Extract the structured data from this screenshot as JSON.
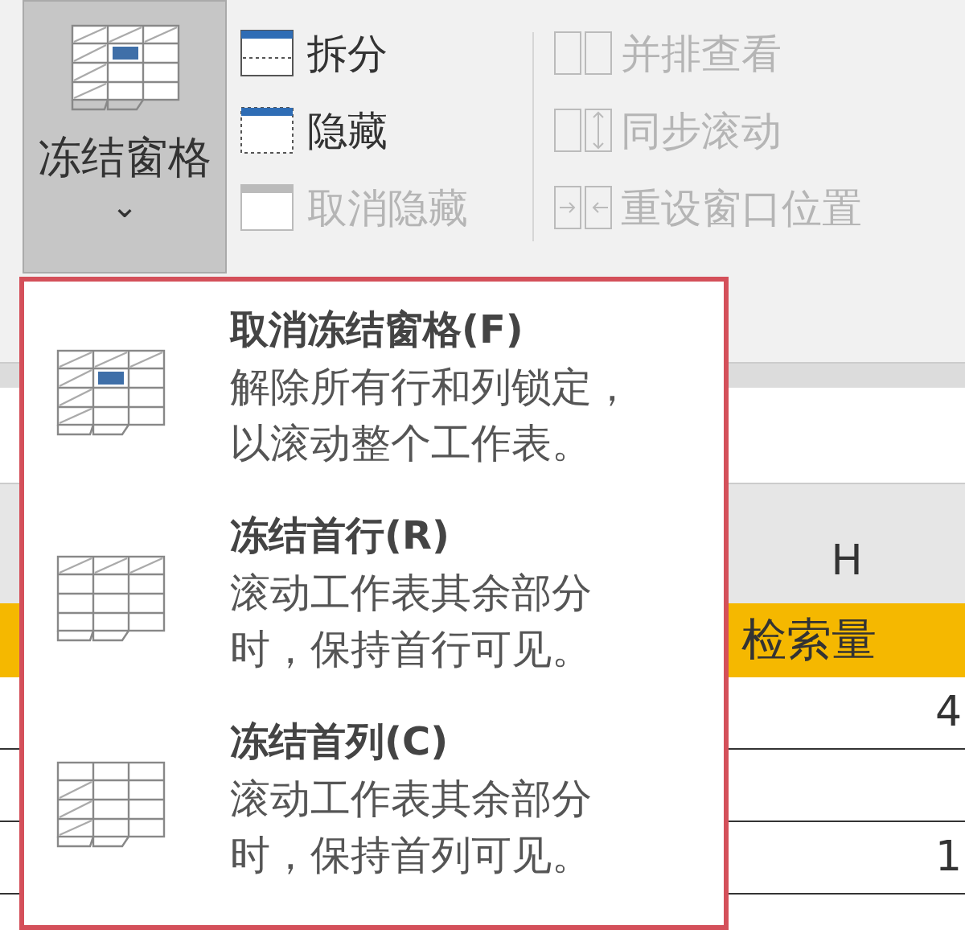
{
  "ribbon": {
    "freeze_button": {
      "label": "冻结窗格",
      "caret": "⌄",
      "expanded": true
    },
    "window_items": [
      {
        "label": "拆分",
        "disabled": false,
        "kind": "split"
      },
      {
        "label": "隐藏",
        "disabled": false,
        "kind": "hide"
      },
      {
        "label": "取消隐藏",
        "disabled": true,
        "kind": "unhide"
      }
    ],
    "window_items_2": [
      {
        "label": "并排查看",
        "disabled": true,
        "kind": "side"
      },
      {
        "label": "同步滚动",
        "disabled": true,
        "kind": "sync"
      },
      {
        "label": "重设窗口位置",
        "disabled": true,
        "kind": "reset"
      }
    ]
  },
  "sheet": {
    "column_header": "H",
    "header_cell": "检索量",
    "rows": [
      {
        "column_h": "4"
      },
      {
        "column_h": ""
      },
      {
        "column_h": "1"
      }
    ]
  },
  "dropdown": {
    "items": [
      {
        "title": "取消冻结窗格(F)",
        "description_lines": [
          "解除所有行和列锁定，",
          "以滚动整个工作表。"
        ],
        "kind": "unfreeze"
      },
      {
        "title": "冻结首行(R)",
        "description_lines": [
          "滚动工作表其余部分",
          "时，保持首行可见。"
        ],
        "kind": "row"
      },
      {
        "title": "冻结首列(C)",
        "description_lines": [
          "滚动工作表其余部分",
          "时，保持首列可见。"
        ],
        "kind": "col"
      }
    ]
  }
}
